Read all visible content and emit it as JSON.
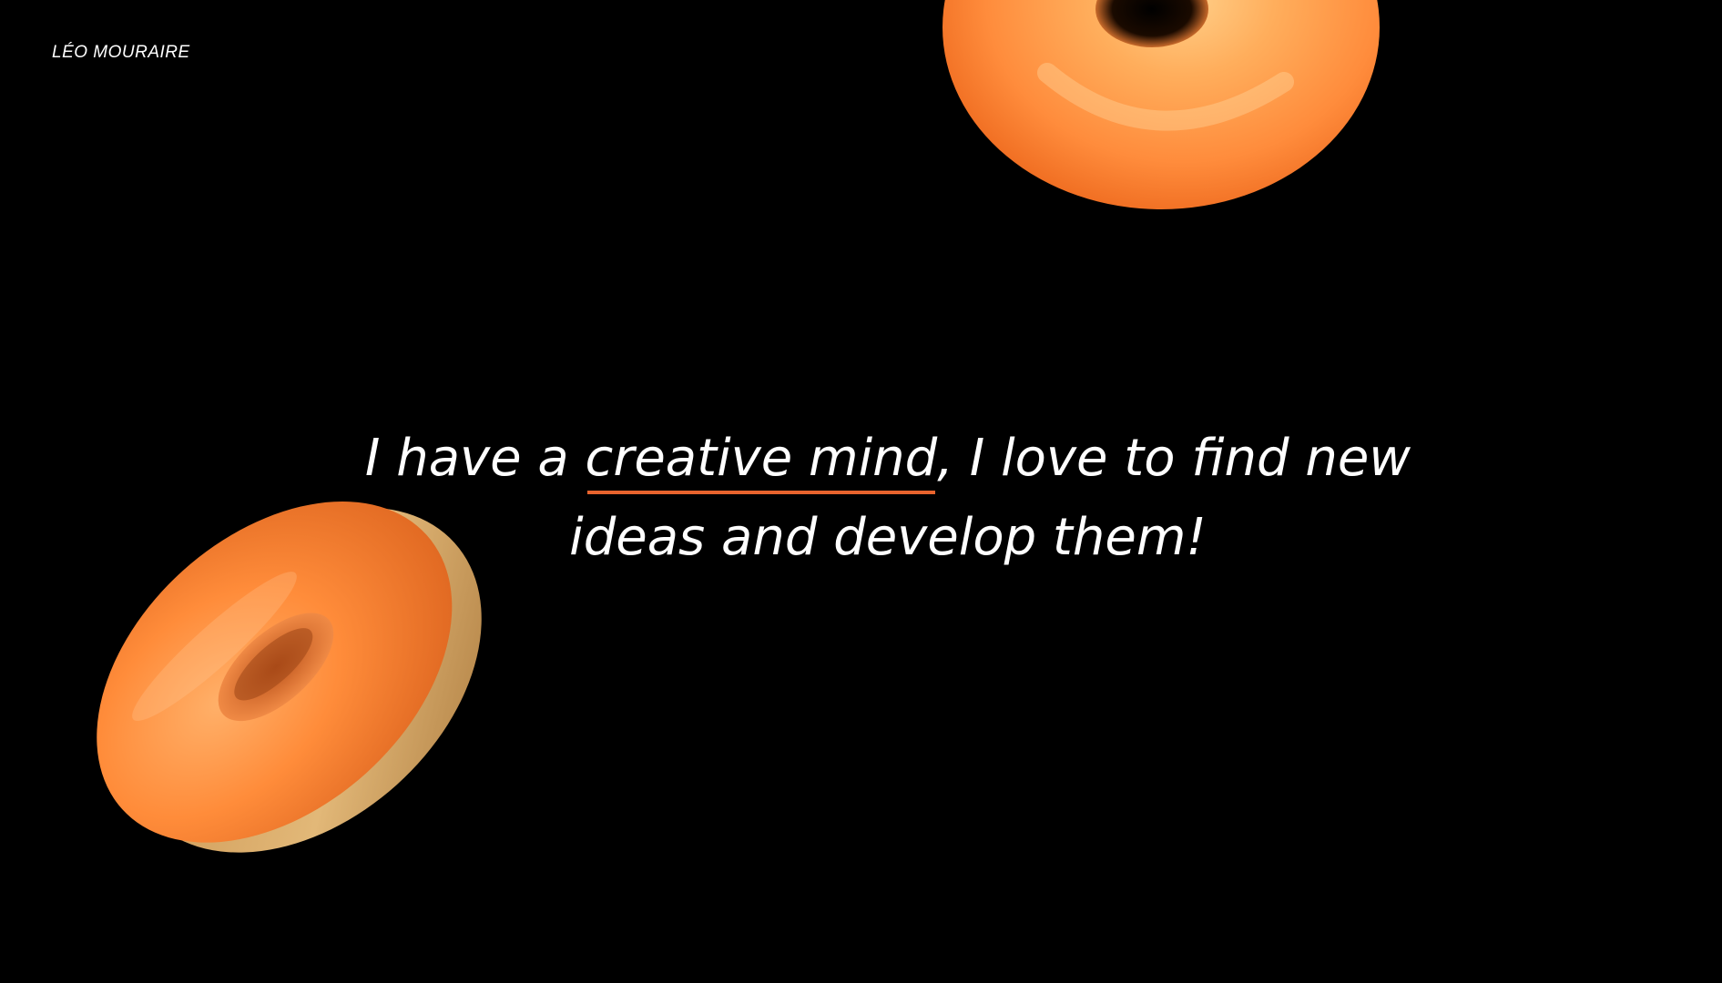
{
  "brand": {
    "name": "LÉO MOURAIRE"
  },
  "headline": {
    "part_before": "I have a ",
    "highlight": "creative mind",
    "part_after": ", I love to find new",
    "line2": "ideas and develop them!"
  },
  "colors": {
    "background": "#000000",
    "text": "#ffffff",
    "accent": "#e8632d",
    "donut_orange": "#ff8a3a",
    "donut_dough": "#d9a866"
  },
  "decor": {
    "donut_top": "donut-icon",
    "donut_left": "donut-icon"
  }
}
